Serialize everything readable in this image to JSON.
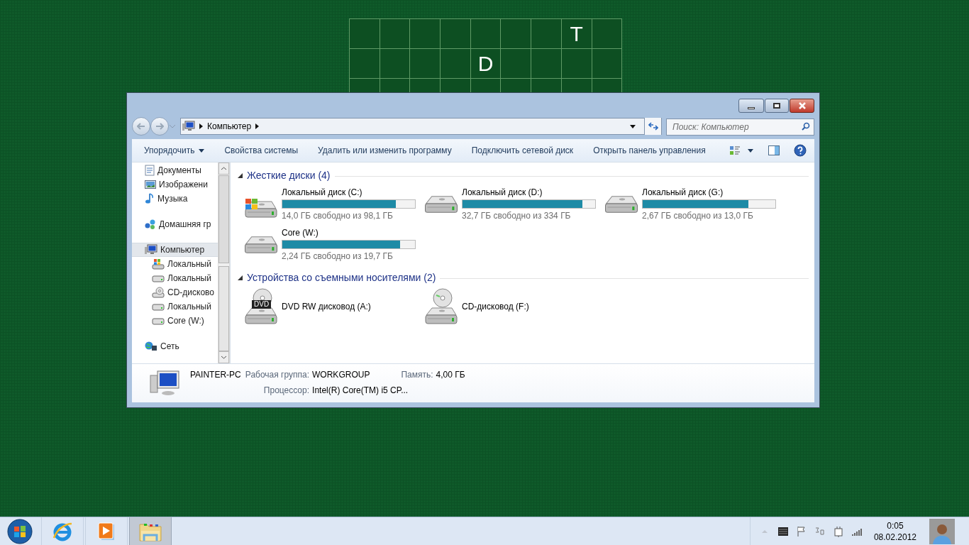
{
  "desktop_board": {
    "rows": [
      [
        null,
        null,
        null,
        null,
        null,
        null,
        null,
        "T",
        null
      ],
      [
        null,
        null,
        null,
        null,
        "D",
        null,
        null,
        null,
        null
      ],
      [
        null,
        null,
        null,
        null,
        null,
        null,
        null,
        null,
        null
      ]
    ]
  },
  "window": {
    "address": {
      "crumbs": [
        "Компьютер"
      ]
    },
    "search": {
      "placeholder": "Поиск: Компьютер"
    },
    "toolbar": [
      {
        "label": "Упорядочить",
        "dropdown": true
      },
      {
        "label": "Свойства системы",
        "dropdown": false
      },
      {
        "label": "Удалить или изменить программу",
        "dropdown": false
      },
      {
        "label": "Подключить сетевой диск",
        "dropdown": false
      },
      {
        "label": "Открыть панель управления",
        "dropdown": false
      }
    ],
    "sidebar": {
      "sections": [
        [
          {
            "label": "Документы",
            "kind": "documents",
            "selected": false
          },
          {
            "label": "Изображени",
            "kind": "pictures",
            "selected": false
          },
          {
            "label": "Музыка",
            "kind": "music",
            "selected": false
          }
        ],
        [
          {
            "label": "Домашняя гр",
            "kind": "homegroup",
            "selected": false
          }
        ],
        [
          {
            "label": "Компьютер",
            "kind": "computer",
            "selected": true,
            "children": [
              {
                "label": "Локальный",
                "kind": "drive-windows",
                "selected": false
              },
              {
                "label": "Локальный",
                "kind": "drive",
                "selected": false
              },
              {
                "label": "CD-дисково",
                "kind": "cd",
                "selected": false
              },
              {
                "label": "Локальный",
                "kind": "drive",
                "selected": false
              },
              {
                "label": "Core (W:)",
                "kind": "drive",
                "selected": false
              }
            ]
          }
        ],
        [
          {
            "label": "Сеть",
            "kind": "network",
            "selected": false
          }
        ]
      ]
    },
    "groups": [
      {
        "title": "Жесткие диски (4)",
        "expanded": true,
        "items": [
          {
            "name": "Локальный диск (C:)",
            "kind": "drive-windows",
            "level": 0.857,
            "free": "14,0 ГБ свободно из 98,1 ГБ"
          },
          {
            "name": "Локальный диск (D:)",
            "kind": "drive",
            "level": 0.902,
            "free": "32,7 ГБ свободно из 334 ГБ"
          },
          {
            "name": "Локальный диск (G:)",
            "kind": "drive",
            "level": 0.795,
            "free": "2,67 ГБ свободно из 13,0 ГБ"
          },
          {
            "name": "Core (W:)",
            "kind": "drive",
            "level": 0.886,
            "free": "2,24 ГБ свободно из 19,7 ГБ"
          }
        ]
      },
      {
        "title": "Устройства со съемными носителями (2)",
        "expanded": true,
        "items": [
          {
            "name": "DVD RW дисковод (A:)",
            "kind": "dvd",
            "badge": "DVD"
          },
          {
            "name": "CD-дисковод (F:)",
            "kind": "cd"
          }
        ]
      }
    ],
    "details": {
      "computer_name": "PAINTER-PC",
      "fields": [
        {
          "label": "Рабочая группа:",
          "value": "WORKGROUP"
        },
        {
          "label": "Память:",
          "value": "4,00 ГБ"
        },
        {
          "label": "Процессор:",
          "value": "Intel(R) Core(TM) i5 CP..."
        }
      ]
    }
  },
  "taskbar": {
    "apps": [
      {
        "kind": "browser",
        "selected": false
      },
      {
        "kind": "media",
        "selected": false
      },
      {
        "kind": "explorer",
        "selected": true
      }
    ],
    "clock": {
      "time": "0:05",
      "date": "08.02.2012"
    }
  }
}
